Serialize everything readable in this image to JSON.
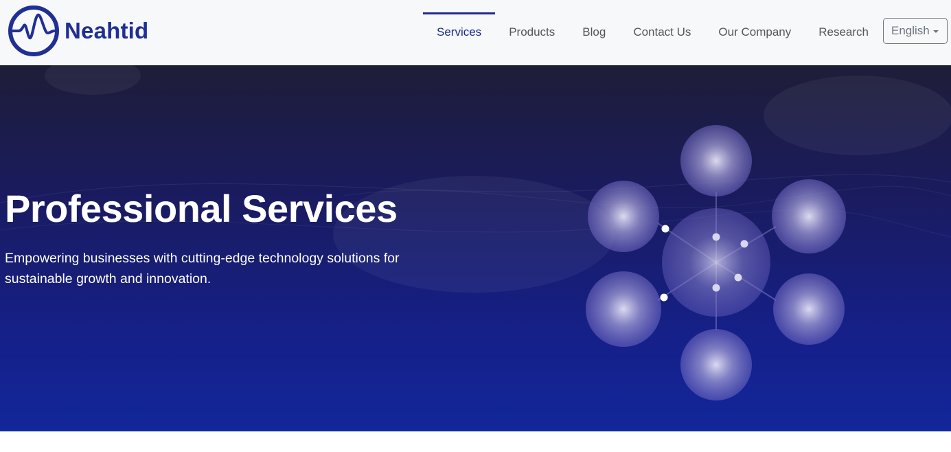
{
  "brand": {
    "name": "Neahtid",
    "logo_icon": "wave-circle-logo",
    "color": "#1f2f94"
  },
  "nav": {
    "items": [
      {
        "label": "Services",
        "active": true
      },
      {
        "label": "Products",
        "active": false
      },
      {
        "label": "Blog",
        "active": false
      },
      {
        "label": "Contact Us",
        "active": false
      },
      {
        "label": "Our Company",
        "active": false
      },
      {
        "label": "Research",
        "active": false
      }
    ],
    "active_color": "#1b2a8a"
  },
  "language": {
    "selected": "English",
    "icon": "chevron-down-icon"
  },
  "hero": {
    "title": "Professional Services",
    "subtitle": "Empowering businesses with cutting-edge technology solutions for sustainable growth and innovation.",
    "graphic_icon": "orb-network-illustration",
    "gradient_top": "#1e1d38",
    "gradient_bottom": "#12279a"
  }
}
